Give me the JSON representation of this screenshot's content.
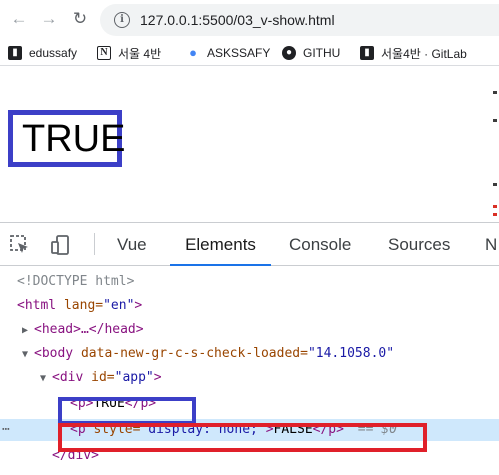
{
  "browser": {
    "url": "127.0.0.1:5500/03_v-show.html",
    "bookmarks": [
      {
        "label": "edussafy",
        "icon": "document-icon"
      },
      {
        "label": "서울 4반",
        "icon": "notion-icon"
      },
      {
        "label": "ASKSSAFY",
        "icon": "pin-icon"
      },
      {
        "label": "GITHU",
        "icon": "github-icon"
      },
      {
        "label": "서울4반 · GitLab",
        "icon": "document-icon"
      }
    ]
  },
  "page": {
    "rendered_text": "TRUE"
  },
  "devtools": {
    "tabs": [
      {
        "label": "Vue",
        "active": false
      },
      {
        "label": "Elements",
        "active": true
      },
      {
        "label": "Console",
        "active": false
      },
      {
        "label": "Sources",
        "active": false
      },
      {
        "label": "N",
        "active": false
      }
    ],
    "dom": {
      "doctype": "<!DOCTYPE html>",
      "html_open": "<html",
      "html_attr": " lang=",
      "html_val": "\"en\"",
      "html_close": ">",
      "head": "<head>…</head>",
      "body_open": "<body",
      "body_attr": " data-new-gr-c-s-check-loaded=",
      "body_val": "\"14.1058.0\"",
      "div_open": "<div",
      "div_attr": " id=",
      "div_val": "\"app\"",
      "div_close_bracket": ">",
      "p1_open": "<p>",
      "p1_text": "TRUE",
      "p1_close": "</p>",
      "p2_open": "<p",
      "p2_attr": " style=",
      "p2_val": "\"display: none;\"",
      "p2_gt": ">",
      "p2_text": "FALSE",
      "p2_close": "</p>",
      "selected_marker": "== $0",
      "div_end": "</div>"
    }
  }
}
